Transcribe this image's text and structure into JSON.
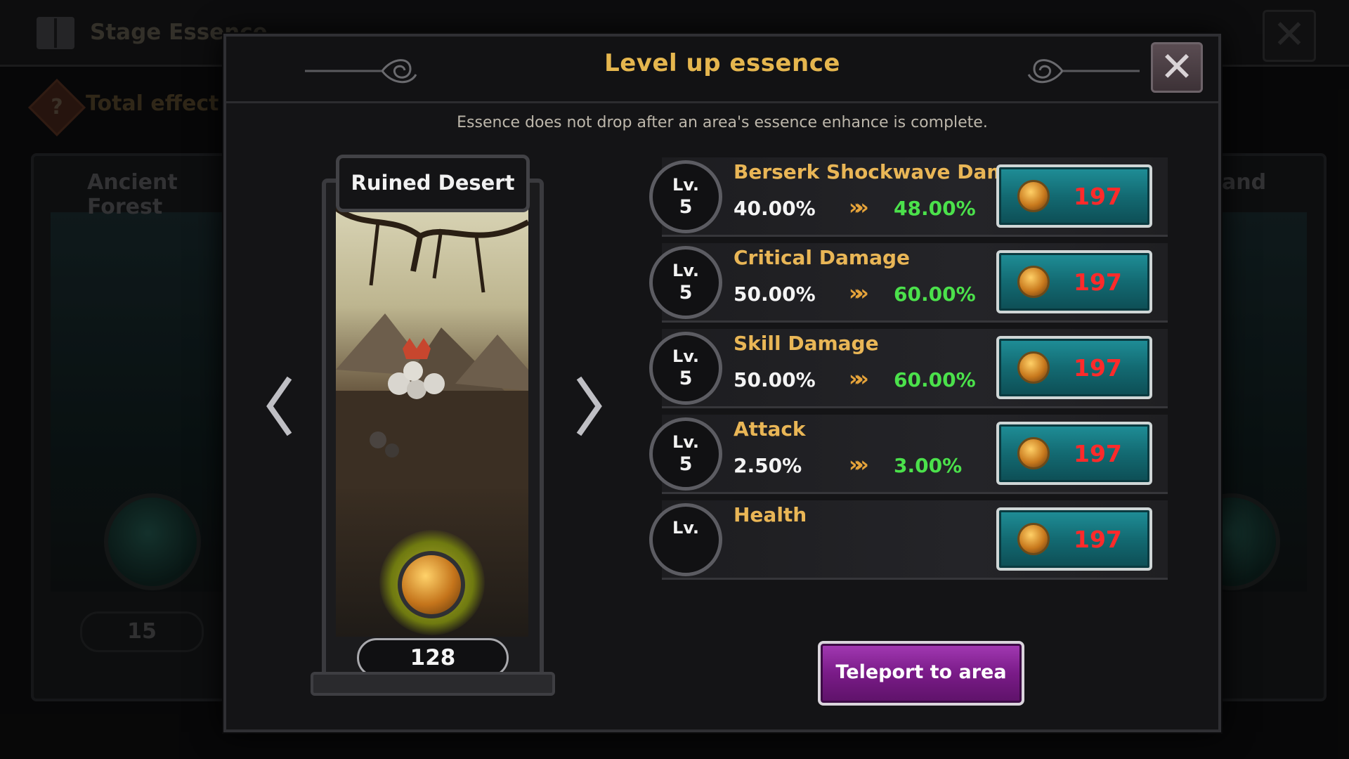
{
  "background": {
    "title": "Stage Essence",
    "total_effect_label": "Total effect",
    "help_symbol": "?",
    "close_symbol": "✕",
    "left_card": {
      "name": "Ancient Forest",
      "count": "15"
    },
    "right_card": {
      "name": "and"
    }
  },
  "modal": {
    "title": "Level up essence",
    "close_symbol": "✕",
    "notice": "Essence does not drop after an area's essence enhance is complete.",
    "stage": {
      "name": "Ruined Desert",
      "essence_count": "128"
    },
    "stats": [
      {
        "lv_label": "Lv.",
        "level": "5",
        "name": "Berserk Shockwave Damage",
        "current": "40.00%",
        "next": "48.00%",
        "cost": "197"
      },
      {
        "lv_label": "Lv.",
        "level": "5",
        "name": "Critical Damage",
        "current": "50.00%",
        "next": "60.00%",
        "cost": "197"
      },
      {
        "lv_label": "Lv.",
        "level": "5",
        "name": "Skill Damage",
        "current": "50.00%",
        "next": "60.00%",
        "cost": "197"
      },
      {
        "lv_label": "Lv.",
        "level": "5",
        "name": "Attack",
        "current": "2.50%",
        "next": "3.00%",
        "cost": "197"
      },
      {
        "lv_label": "Lv.",
        "level": "",
        "name": "Health",
        "current": "",
        "next": "",
        "cost": "197"
      }
    ],
    "arrow_glyph": "»»",
    "teleport_label": "Teleport to area"
  },
  "colors": {
    "title_gold": "#e5b64e",
    "stat_name_gold": "#e9b656",
    "next_value_green": "#4be14b",
    "cost_red": "#ff2a2a",
    "cost_button_teal": "#136a72",
    "teleport_purple": "#7a1b88"
  }
}
